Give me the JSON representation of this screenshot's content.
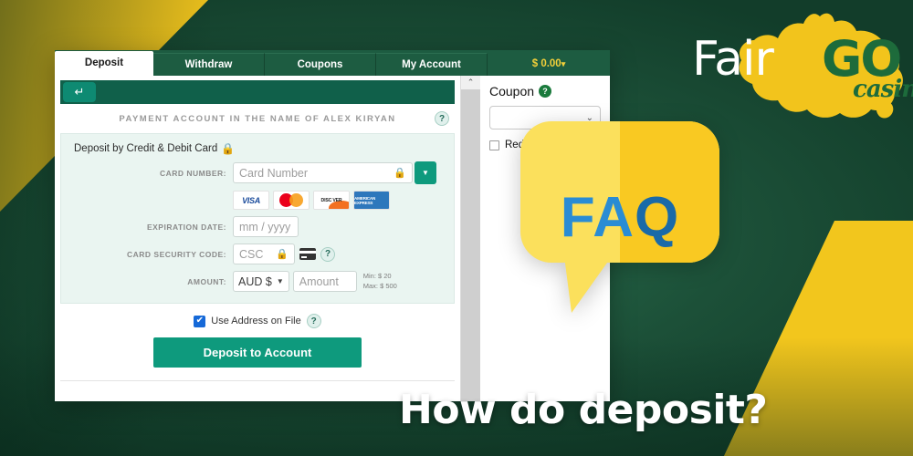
{
  "caption": "How do deposit?",
  "brand": {
    "name_light": "Fair",
    "name_bold": "GO",
    "sub": "casino",
    "colors": {
      "yellow": "#f2c41c",
      "dark_green": "#1d6b3b",
      "bg_green": "#1c5038"
    }
  },
  "faq": {
    "label": "FAQ",
    "color_front": "#2a8cd4",
    "color_back": "#1a6aa8",
    "bubble": "#fbe05c"
  },
  "window": {
    "tabs": [
      {
        "label": "Deposit",
        "active": true
      },
      {
        "label": "Withdraw",
        "active": false
      },
      {
        "label": "Coupons",
        "active": false
      },
      {
        "label": "My Account",
        "active": false
      }
    ],
    "balance": "$ 0.00",
    "balance_caret": "▾",
    "toolbar": {
      "back_icon": "↵"
    },
    "account_banner": {
      "text": "PAYMENT ACCOUNT IN THE NAME OF ALEX KIRYAN",
      "help": "?"
    },
    "form": {
      "title": "Deposit by Credit & Debit Card",
      "lock_icon": "🔒",
      "card_number": {
        "label": "CARD NUMBER:",
        "placeholder": "Card Number",
        "value": "",
        "lock_icon": "🔒",
        "dropdown_caret": "▼"
      },
      "brands": [
        {
          "name": "visa",
          "text": "VISA"
        },
        {
          "name": "mastercard",
          "text": ""
        },
        {
          "name": "discover",
          "text": "DISC VER"
        },
        {
          "name": "amex",
          "text": "AMERICAN EXPRESS"
        }
      ],
      "expiration": {
        "label": "EXPIRATION DATE:",
        "placeholder": "mm / yyyy",
        "value": ""
      },
      "csc": {
        "label": "CARD SECURITY CODE:",
        "placeholder": "CSC",
        "value": "",
        "lock_icon": "🔒",
        "help": "?"
      },
      "amount": {
        "label": "AMOUNT:",
        "currency": "AUD $",
        "currency_caret": "⌄",
        "placeholder": "Amount",
        "value": "",
        "min": "Min: $ 20",
        "max": "Max: $ 500"
      }
    },
    "address": {
      "label": "Use Address on File",
      "checked": true,
      "check_icon": "✔",
      "help": "?"
    },
    "submit": "Deposit to Account",
    "scrollbar": {
      "up_icon": "⌃"
    },
    "coupon": {
      "title": "Coupon",
      "help": "?",
      "select_value": "",
      "select_caret": "⌄",
      "redeem_label": "Redeem",
      "redeem_checked": false
    }
  }
}
